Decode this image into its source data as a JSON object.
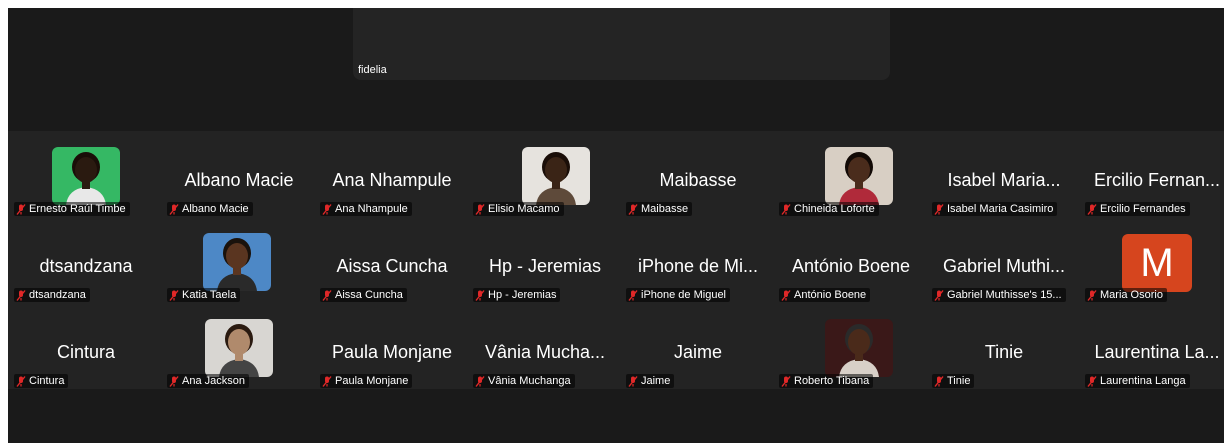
{
  "active_speaker": {
    "name": "fidelia"
  },
  "participants": [
    {
      "name": "Ernesto Raúl Timbe",
      "display": "",
      "video": "photo-green"
    },
    {
      "name": "Albano Macie",
      "display": "Albano Macie",
      "video": "none"
    },
    {
      "name": "Ana Nhampule",
      "display": "Ana Nhampule",
      "video": "none"
    },
    {
      "name": "Elisio Macamo",
      "display": "",
      "video": "photo-white"
    },
    {
      "name": "Maibasse",
      "display": "Maibasse",
      "video": "none"
    },
    {
      "name": "Chineida Loforte",
      "display": "",
      "video": "photo-light"
    },
    {
      "name": "Isabel Maria Casimiro",
      "display": "Isabel Maria...",
      "video": "none"
    },
    {
      "name": "Ercilio Fernandes",
      "display": "Ercilio Fernan...",
      "video": "none"
    },
    {
      "name": "dtsandzana",
      "display": "dtsandzana",
      "video": "none"
    },
    {
      "name": "Katia Taela",
      "display": "",
      "video": "photo-blue"
    },
    {
      "name": "Aissa Cuncha",
      "display": "Aissa Cuncha",
      "video": "none"
    },
    {
      "name": "Hp - Jeremias",
      "display": "Hp - Jeremias",
      "video": "none"
    },
    {
      "name": "iPhone de Miguel",
      "display": "iPhone de Mi...",
      "video": "none"
    },
    {
      "name": "António Boene",
      "display": "António Boene",
      "video": "none"
    },
    {
      "name": "Gabriel Muthisse's 15...",
      "display": "Gabriel Muthi...",
      "video": "none"
    },
    {
      "name": "Maria Osorio",
      "display": "",
      "video": "monogram",
      "monogram": "M"
    },
    {
      "name": "Cintura",
      "display": "Cintura",
      "video": "none"
    },
    {
      "name": "Ana Jackson",
      "display": "",
      "video": "photo-gray"
    },
    {
      "name": "Paula Monjane",
      "display": "Paula Monjane",
      "video": "none"
    },
    {
      "name": "Vânia Muchanga",
      "display": "Vânia Mucha...",
      "video": "none"
    },
    {
      "name": "Jaime",
      "display": "Jaime",
      "video": "none"
    },
    {
      "name": "Roberto Tibana",
      "display": "",
      "video": "photo-dark"
    },
    {
      "name": "Tinie",
      "display": "Tinie",
      "video": "none"
    },
    {
      "name": "Laurentina Langa",
      "display": "Laurentina La...",
      "video": "none"
    }
  ],
  "colors": {
    "background": "#1a1a1a",
    "tile_strip": "#232323",
    "muted_icon": "#e02828",
    "monogram_bg": "#d6451e"
  },
  "icons": {
    "muted": "mic-muted-icon"
  }
}
